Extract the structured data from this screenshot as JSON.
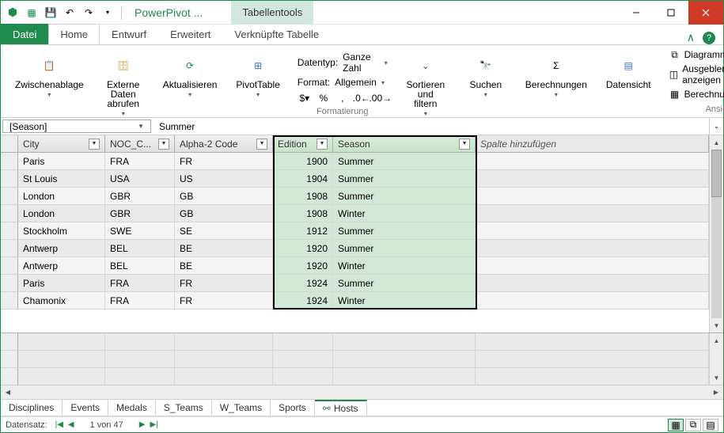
{
  "title": "PowerPivot ...",
  "contextTab": "Tabellentools",
  "ribbonTabs": {
    "file": "Datei",
    "home": "Home",
    "design": "Entwurf",
    "advanced": "Erweitert",
    "linked": "Verknüpfte Tabelle"
  },
  "ribbon": {
    "clipboard": "Zwischenablage",
    "extdata": "Externe Daten\nabrufen",
    "refresh": "Aktualisieren",
    "pivot": "PivotTable",
    "datatype_lbl": "Datentyp:",
    "datatype_val": "Ganze Zahl",
    "format_lbl": "Format:",
    "format_val": "Allgemein",
    "sortfilter": "Sortieren\nund filtern",
    "find": "Suchen",
    "calc": "Berechnungen",
    "dataview": "Datensicht",
    "diagview": "Diagrammsicht",
    "showhidden": "Ausgeblendete anzeigen",
    "calcarea": "Berechnungsbereich",
    "fmt_grp": "Formatierung",
    "view_grp": "Ansicht"
  },
  "namebox": "[Season]",
  "formula": "Summer",
  "columns": {
    "city": "City",
    "noc": "NOC_C...",
    "a2": "Alpha-2 Code",
    "ed": "Edition",
    "se": "Season",
    "add": "Spalte hinzufügen"
  },
  "rows": [
    {
      "city": "Paris",
      "noc": "FRA",
      "a2": "FR",
      "ed": "1900",
      "se": "Summer"
    },
    {
      "city": "St Louis",
      "noc": "USA",
      "a2": "US",
      "ed": "1904",
      "se": "Summer"
    },
    {
      "city": "London",
      "noc": "GBR",
      "a2": "GB",
      "ed": "1908",
      "se": "Summer"
    },
    {
      "city": "London",
      "noc": "GBR",
      "a2": "GB",
      "ed": "1908",
      "se": "Winter"
    },
    {
      "city": "Stockholm",
      "noc": "SWE",
      "a2": "SE",
      "ed": "1912",
      "se": "Summer"
    },
    {
      "city": "Antwerp",
      "noc": "BEL",
      "a2": "BE",
      "ed": "1920",
      "se": "Summer"
    },
    {
      "city": "Antwerp",
      "noc": "BEL",
      "a2": "BE",
      "ed": "1920",
      "se": "Winter"
    },
    {
      "city": "Paris",
      "noc": "FRA",
      "a2": "FR",
      "ed": "1924",
      "se": "Summer"
    },
    {
      "city": "Chamonix",
      "noc": "FRA",
      "a2": "FR",
      "ed": "1924",
      "se": "Winter"
    }
  ],
  "sheets": [
    "Disciplines",
    "Events",
    "Medals",
    "S_Teams",
    "W_Teams",
    "Sports",
    "Hosts"
  ],
  "activeSheet": 6,
  "status": {
    "record": "Datensatz:",
    "pos": "1 von 47"
  }
}
